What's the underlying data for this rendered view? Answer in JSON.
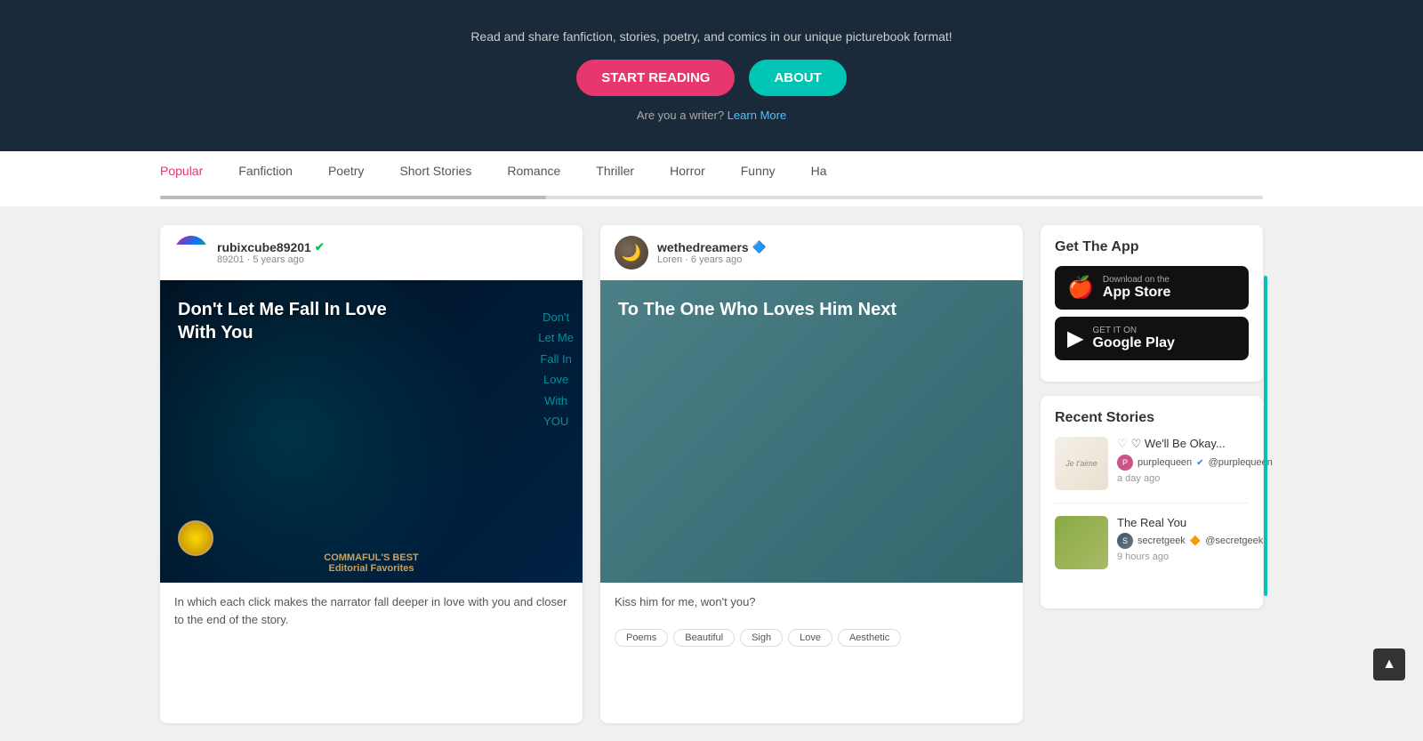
{
  "hero": {
    "subtitle": "Read and share fanfiction, stories, poetry, and comics in our unique picturebook format!",
    "btn_start": "START READING",
    "btn_about": "ABOUT",
    "writer_text": "Are you a writer?",
    "writer_link": "Learn More"
  },
  "nav": {
    "tabs": [
      {
        "label": "Popular",
        "active": true
      },
      {
        "label": "Fanfiction",
        "active": false
      },
      {
        "label": "Poetry",
        "active": false
      },
      {
        "label": "Short Stories",
        "active": false
      },
      {
        "label": "Romance",
        "active": false
      },
      {
        "label": "Thriller",
        "active": false
      },
      {
        "label": "Horror",
        "active": false
      },
      {
        "label": "Funny",
        "active": false
      },
      {
        "label": "Ha",
        "active": false
      }
    ]
  },
  "cards": [
    {
      "username": "rubixcube89201",
      "verified": true,
      "verified_type": "green",
      "meta": "89201 · 5 years ago",
      "title": "Don't Let Me Fall In Love With You",
      "title_side": "Don't\nLet Me\nFall In\nLove\nWith\nYOU",
      "badge": "COMMAFUL'S BEST\nEditorial Favorites",
      "description": "In which each click makes the narrator fall deeper in love with you and closer to the end of the story.",
      "tags": []
    },
    {
      "username": "wethedreamers",
      "verified": true,
      "verified_type": "blue",
      "meta": "Loren · 6 years ago",
      "title": "To The One Who Loves Him Next",
      "description": "Kiss him for me, won't you?",
      "tags": [
        "Poems",
        "Beautiful",
        "Sigh",
        "Love",
        "Aesthetic"
      ]
    }
  ],
  "sidebar": {
    "app_section_title": "Get The App",
    "app_store_sub": "Download on the",
    "app_store_main": "App Store",
    "google_play_sub": "GET IT ON",
    "google_play_main": "Google Play",
    "recent_title": "Recent Stories",
    "recent_stories": [
      {
        "title": "♡ We'll Be Okay...",
        "username": "purplequeen",
        "handle": "@purplequeen",
        "verified": true,
        "verified_type": "blue",
        "time": "a day ago",
        "thumb": "je-taime"
      },
      {
        "title": "The Real You",
        "username": "secretgeek",
        "handle": "@secretgeek",
        "verified": true,
        "verified_type": "gold",
        "time": "9 hours ago",
        "thumb": "green-photo"
      }
    ]
  },
  "scroll_up": "▲"
}
